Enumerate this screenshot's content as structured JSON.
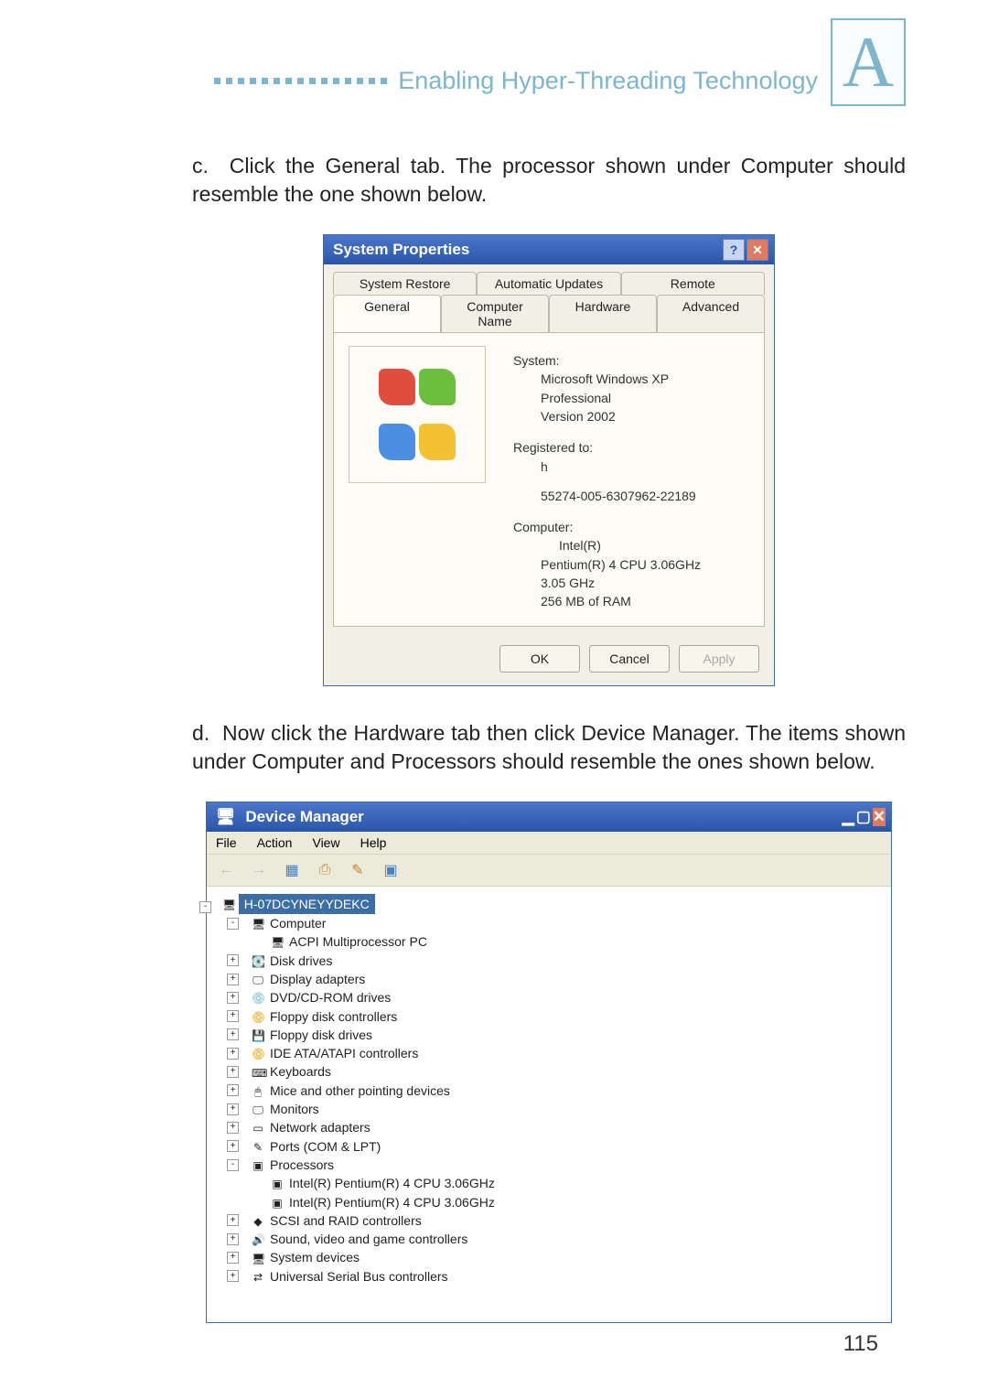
{
  "header": {
    "section_title": "Enabling Hyper-Threading Technology",
    "corner_letter": "A"
  },
  "paragraph_c": "c.  Click the General tab. The processor shown under Computer should resemble the one shown below.",
  "paragraph_d": "d.  Now click the Hardware tab then click Device Manager. The items shown under Computer and Processors should resemble the ones shown below.",
  "sysprops": {
    "title": "System Properties",
    "help_glyph": "?",
    "close_glyph": "✕",
    "tabs_top": {
      "t1": "System Restore",
      "t2": "Automatic Updates",
      "t3": "Remote"
    },
    "tabs_bottom": {
      "t1": "General",
      "t2": "Computer Name",
      "t3": "Hardware",
      "t4": "Advanced"
    },
    "info": {
      "system_label": "System:",
      "os": "Microsoft Windows XP",
      "edition": "Professional",
      "version": "Version 2002",
      "registered_label": "Registered to:",
      "registered_name": "h",
      "serial": "55274-005-6307962-22189",
      "computer_label": "Computer:",
      "cpu_brand": "Intel(R)",
      "cpu_model": "Pentium(R) 4 CPU 3.06GHz",
      "cpu_speed": "3.05 GHz",
      "ram": "256 MB of RAM"
    },
    "buttons": {
      "ok": "OK",
      "cancel": "Cancel",
      "apply": "Apply"
    }
  },
  "devmgr": {
    "title": "Device Manager",
    "min_glyph": "▁",
    "max_glyph": "▢",
    "close_glyph": "✕",
    "menu": {
      "file": "File",
      "action": "Action",
      "view": "View",
      "help": "Help"
    },
    "toolbar": {
      "back": "←",
      "fwd": "→",
      "i1": "▦",
      "i2": "⎙",
      "i3": "✎",
      "i4": "▣"
    },
    "root": "H-07DCYNEYYDEKC",
    "items": [
      {
        "exp": "-",
        "level": 1,
        "icon": "🖥",
        "label": "Computer"
      },
      {
        "exp": "",
        "level": 2,
        "icon": "🖥",
        "label": "ACPI Multiprocessor PC"
      },
      {
        "exp": "+",
        "level": 1,
        "icon": "💽",
        "label": "Disk drives"
      },
      {
        "exp": "+",
        "level": 1,
        "icon": "🖵",
        "label": "Display adapters"
      },
      {
        "exp": "+",
        "level": 1,
        "icon": "💿",
        "label": "DVD/CD-ROM drives"
      },
      {
        "exp": "+",
        "level": 1,
        "icon": "📀",
        "label": "Floppy disk controllers"
      },
      {
        "exp": "+",
        "level": 1,
        "icon": "💾",
        "label": "Floppy disk drives"
      },
      {
        "exp": "+",
        "level": 1,
        "icon": "📀",
        "label": "IDE ATA/ATAPI controllers"
      },
      {
        "exp": "+",
        "level": 1,
        "icon": "⌨",
        "label": "Keyboards"
      },
      {
        "exp": "+",
        "level": 1,
        "icon": "🖱",
        "label": "Mice and other pointing devices"
      },
      {
        "exp": "+",
        "level": 1,
        "icon": "🖵",
        "label": "Monitors"
      },
      {
        "exp": "+",
        "level": 1,
        "icon": "▭",
        "label": "Network adapters"
      },
      {
        "exp": "+",
        "level": 1,
        "icon": "✎",
        "label": "Ports (COM & LPT)"
      },
      {
        "exp": "-",
        "level": 1,
        "icon": "▣",
        "label": "Processors"
      },
      {
        "exp": "",
        "level": 2,
        "icon": "▣",
        "label": "Intel(R) Pentium(R) 4 CPU 3.06GHz"
      },
      {
        "exp": "",
        "level": 2,
        "icon": "▣",
        "label": "Intel(R) Pentium(R) 4 CPU 3.06GHz"
      },
      {
        "exp": "+",
        "level": 1,
        "icon": "◆",
        "label": "SCSI and RAID controllers"
      },
      {
        "exp": "+",
        "level": 1,
        "icon": "🔊",
        "label": "Sound, video and game controllers"
      },
      {
        "exp": "+",
        "level": 1,
        "icon": "🖥",
        "label": "System devices"
      },
      {
        "exp": "+",
        "level": 1,
        "icon": "⇄",
        "label": "Universal Serial Bus controllers"
      }
    ]
  },
  "page_number": "115"
}
